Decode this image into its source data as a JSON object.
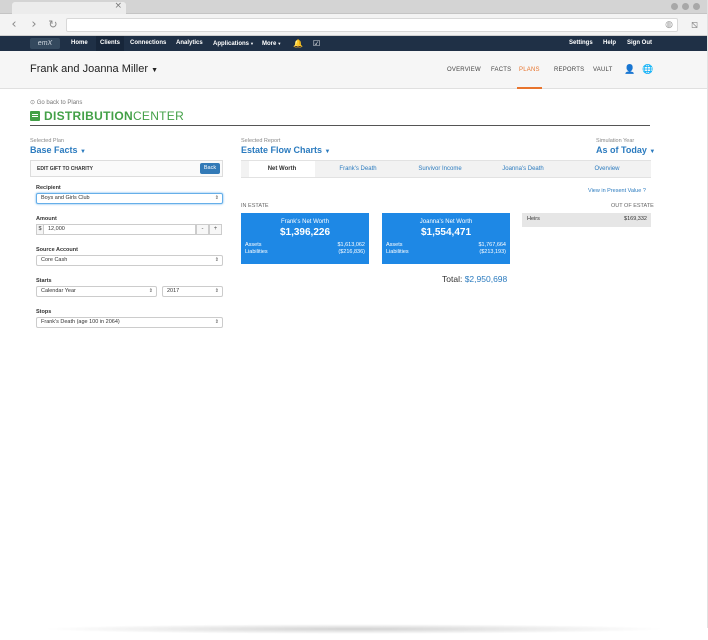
{
  "browser": {
    "tab_close": "×",
    "url": ""
  },
  "topnav": {
    "logo": "emX",
    "items": [
      "Home",
      "Clients",
      "Connections",
      "Analytics",
      "Applications",
      "More"
    ],
    "right_items": [
      "Settings",
      "Help",
      "Sign Out"
    ]
  },
  "client": {
    "name": "Frank and Joanna Miller",
    "nav": [
      "OVERVIEW",
      "FACTS",
      "PLANS",
      "REPORTS",
      "VAULT"
    ],
    "active_nav": "PLANS"
  },
  "page": {
    "back_link": "Go back to Plans",
    "title_bold": "DISTRIBUTION",
    "title_light": "CENTER"
  },
  "selectors": {
    "plan_label": "Selected Plan",
    "plan_value": "Base Facts",
    "report_label": "Selected Report",
    "report_value": "Estate Flow Charts",
    "year_label": "Simulation Year",
    "year_value": "As of Today"
  },
  "gift_form": {
    "title": "EDIT GIFT TO CHARITY",
    "back_label": "Back",
    "recipient_label": "Recipient",
    "recipient_value": "Boys and Girls Club",
    "amount_label": "Amount",
    "amount_prefix": "$",
    "amount_value": "12,000",
    "minus_label": "-",
    "plus_label": "+",
    "source_label": "Source Account",
    "source_value": "Core Cash",
    "starts_label": "Starts",
    "starts_value": "Calendar Year",
    "starts_year": "2017",
    "stops_label": "Stops",
    "stops_value": "Frank's Death (age 100 in 2064)"
  },
  "tabs": [
    "Net Worth",
    "Frank's Death",
    "Survivor Income",
    "Joanna's Death",
    "Overview"
  ],
  "estate": {
    "in_label": "IN ESTATE",
    "out_label": "OUT OF ESTATE",
    "present_value_link": "View in Present Value",
    "frank": {
      "title": "Frank's Net Worth",
      "total": "$1,396,226",
      "assets_label": "Assets",
      "assets": "$1,613,062",
      "liabilities_label": "Liabilities",
      "liabilities": "($216,836)"
    },
    "joanna": {
      "title": "Joanna's Net Worth",
      "total": "$1,554,471",
      "assets_label": "Assets",
      "assets": "$1,767,664",
      "liabilities_label": "Liabilities",
      "liabilities": "($213,193)"
    },
    "heirs_label": "Heirs",
    "heirs_value": "$169,332",
    "total_label": "Total:",
    "total_value": "$2,950,698"
  },
  "colors": {
    "nav_bg": "#1f3046",
    "accent": "#2b7bbf",
    "brand_green": "#43a047",
    "card_blue": "#1e88e5",
    "active_orange": "#e8742d"
  }
}
